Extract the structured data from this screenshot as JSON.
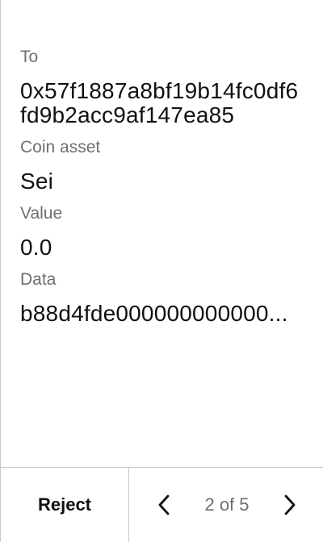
{
  "fields": [
    {
      "label": "To",
      "value": "0x57f1887a8bf19b14fc0df6fd9b2acc9af147ea85"
    },
    {
      "label": "Coin asset",
      "value": "Sei"
    },
    {
      "label": "Value",
      "value": "0.0"
    },
    {
      "label": "Data",
      "value": "b88d4fde000000000000..."
    }
  ],
  "footer": {
    "reject_label": "Reject",
    "page_indicator": "2 of 5",
    "prev_icon": "chevron-left-icon",
    "next_icon": "chevron-right-icon"
  }
}
